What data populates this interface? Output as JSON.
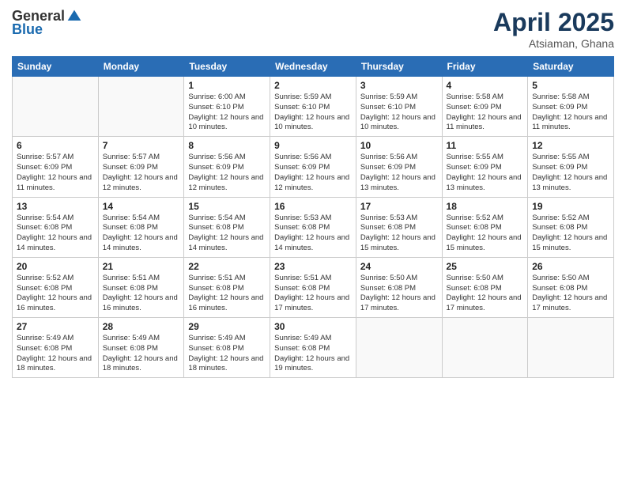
{
  "header": {
    "logo_general": "General",
    "logo_blue": "Blue",
    "title": "April 2025",
    "subtitle": "Atsiaman, Ghana"
  },
  "calendar": {
    "headers": [
      "Sunday",
      "Monday",
      "Tuesday",
      "Wednesday",
      "Thursday",
      "Friday",
      "Saturday"
    ],
    "weeks": [
      [
        {
          "day": "",
          "info": ""
        },
        {
          "day": "",
          "info": ""
        },
        {
          "day": "1",
          "info": "Sunrise: 6:00 AM\nSunset: 6:10 PM\nDaylight: 12 hours and 10 minutes."
        },
        {
          "day": "2",
          "info": "Sunrise: 5:59 AM\nSunset: 6:10 PM\nDaylight: 12 hours and 10 minutes."
        },
        {
          "day": "3",
          "info": "Sunrise: 5:59 AM\nSunset: 6:10 PM\nDaylight: 12 hours and 10 minutes."
        },
        {
          "day": "4",
          "info": "Sunrise: 5:58 AM\nSunset: 6:09 PM\nDaylight: 12 hours and 11 minutes."
        },
        {
          "day": "5",
          "info": "Sunrise: 5:58 AM\nSunset: 6:09 PM\nDaylight: 12 hours and 11 minutes."
        }
      ],
      [
        {
          "day": "6",
          "info": "Sunrise: 5:57 AM\nSunset: 6:09 PM\nDaylight: 12 hours and 11 minutes."
        },
        {
          "day": "7",
          "info": "Sunrise: 5:57 AM\nSunset: 6:09 PM\nDaylight: 12 hours and 12 minutes."
        },
        {
          "day": "8",
          "info": "Sunrise: 5:56 AM\nSunset: 6:09 PM\nDaylight: 12 hours and 12 minutes."
        },
        {
          "day": "9",
          "info": "Sunrise: 5:56 AM\nSunset: 6:09 PM\nDaylight: 12 hours and 12 minutes."
        },
        {
          "day": "10",
          "info": "Sunrise: 5:56 AM\nSunset: 6:09 PM\nDaylight: 12 hours and 13 minutes."
        },
        {
          "day": "11",
          "info": "Sunrise: 5:55 AM\nSunset: 6:09 PM\nDaylight: 12 hours and 13 minutes."
        },
        {
          "day": "12",
          "info": "Sunrise: 5:55 AM\nSunset: 6:09 PM\nDaylight: 12 hours and 13 minutes."
        }
      ],
      [
        {
          "day": "13",
          "info": "Sunrise: 5:54 AM\nSunset: 6:08 PM\nDaylight: 12 hours and 14 minutes."
        },
        {
          "day": "14",
          "info": "Sunrise: 5:54 AM\nSunset: 6:08 PM\nDaylight: 12 hours and 14 minutes."
        },
        {
          "day": "15",
          "info": "Sunrise: 5:54 AM\nSunset: 6:08 PM\nDaylight: 12 hours and 14 minutes."
        },
        {
          "day": "16",
          "info": "Sunrise: 5:53 AM\nSunset: 6:08 PM\nDaylight: 12 hours and 14 minutes."
        },
        {
          "day": "17",
          "info": "Sunrise: 5:53 AM\nSunset: 6:08 PM\nDaylight: 12 hours and 15 minutes."
        },
        {
          "day": "18",
          "info": "Sunrise: 5:52 AM\nSunset: 6:08 PM\nDaylight: 12 hours and 15 minutes."
        },
        {
          "day": "19",
          "info": "Sunrise: 5:52 AM\nSunset: 6:08 PM\nDaylight: 12 hours and 15 minutes."
        }
      ],
      [
        {
          "day": "20",
          "info": "Sunrise: 5:52 AM\nSunset: 6:08 PM\nDaylight: 12 hours and 16 minutes."
        },
        {
          "day": "21",
          "info": "Sunrise: 5:51 AM\nSunset: 6:08 PM\nDaylight: 12 hours and 16 minutes."
        },
        {
          "day": "22",
          "info": "Sunrise: 5:51 AM\nSunset: 6:08 PM\nDaylight: 12 hours and 16 minutes."
        },
        {
          "day": "23",
          "info": "Sunrise: 5:51 AM\nSunset: 6:08 PM\nDaylight: 12 hours and 17 minutes."
        },
        {
          "day": "24",
          "info": "Sunrise: 5:50 AM\nSunset: 6:08 PM\nDaylight: 12 hours and 17 minutes."
        },
        {
          "day": "25",
          "info": "Sunrise: 5:50 AM\nSunset: 6:08 PM\nDaylight: 12 hours and 17 minutes."
        },
        {
          "day": "26",
          "info": "Sunrise: 5:50 AM\nSunset: 6:08 PM\nDaylight: 12 hours and 17 minutes."
        }
      ],
      [
        {
          "day": "27",
          "info": "Sunrise: 5:49 AM\nSunset: 6:08 PM\nDaylight: 12 hours and 18 minutes."
        },
        {
          "day": "28",
          "info": "Sunrise: 5:49 AM\nSunset: 6:08 PM\nDaylight: 12 hours and 18 minutes."
        },
        {
          "day": "29",
          "info": "Sunrise: 5:49 AM\nSunset: 6:08 PM\nDaylight: 12 hours and 18 minutes."
        },
        {
          "day": "30",
          "info": "Sunrise: 5:49 AM\nSunset: 6:08 PM\nDaylight: 12 hours and 19 minutes."
        },
        {
          "day": "",
          "info": ""
        },
        {
          "day": "",
          "info": ""
        },
        {
          "day": "",
          "info": ""
        }
      ]
    ]
  }
}
